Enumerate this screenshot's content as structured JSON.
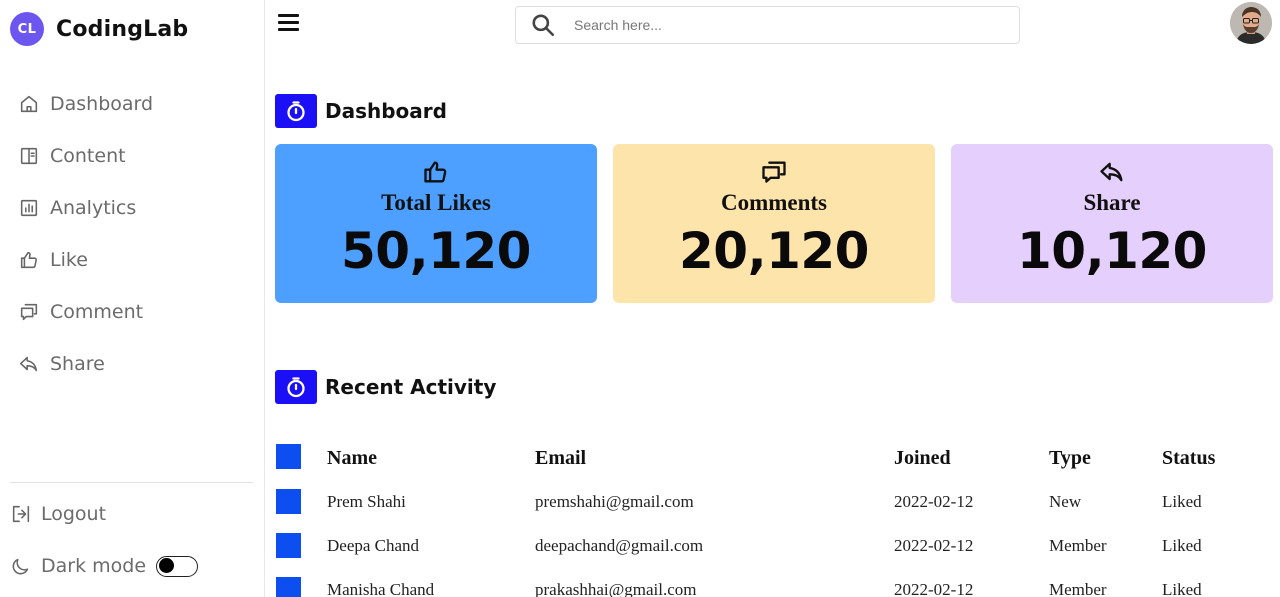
{
  "app": {
    "logo_badge": "CL",
    "logo_text": "CodingLab"
  },
  "sidebar": {
    "items": [
      {
        "label": "Dashboard",
        "icon": "home-icon"
      },
      {
        "label": "Content",
        "icon": "content-icon"
      },
      {
        "label": "Analytics",
        "icon": "analytics-icon"
      },
      {
        "label": "Like",
        "icon": "thumbs-up-icon"
      },
      {
        "label": "Comment",
        "icon": "comment-icon"
      },
      {
        "label": "Share",
        "icon": "share-icon"
      }
    ],
    "logout_label": "Logout",
    "darkmode_label": "Dark mode",
    "darkmode_on": false
  },
  "search": {
    "placeholder": "Search here..."
  },
  "dashboard": {
    "title": "Dashboard",
    "cards": [
      {
        "label": "Total Likes",
        "value": "50,120",
        "icon": "thumbs-up-icon",
        "color": "#4da0ff"
      },
      {
        "label": "Comments",
        "value": "20,120",
        "icon": "comments-icon",
        "color": "#fde4aa"
      },
      {
        "label": "Share",
        "value": "10,120",
        "icon": "share-icon",
        "color": "#e5cffc"
      }
    ]
  },
  "activity": {
    "title": "Recent Activity",
    "columns": [
      "Name",
      "Email",
      "Joined",
      "Type",
      "Status"
    ],
    "rows": [
      {
        "name": "Prem Shahi",
        "email": "premshahi@gmail.com",
        "joined": "2022-02-12",
        "type": "New",
        "status": "Liked"
      },
      {
        "name": "Deepa Chand",
        "email": "deepachand@gmail.com",
        "joined": "2022-02-12",
        "type": "Member",
        "status": "Liked"
      },
      {
        "name": "Manisha Chand",
        "email": "prakashhai@gmail.com",
        "joined": "2022-02-12",
        "type": "Member",
        "status": "Liked"
      }
    ]
  },
  "colors": {
    "accent": "#1a0ff5",
    "logo": "#6d55f0",
    "checkbox": "#0d4ef0"
  }
}
